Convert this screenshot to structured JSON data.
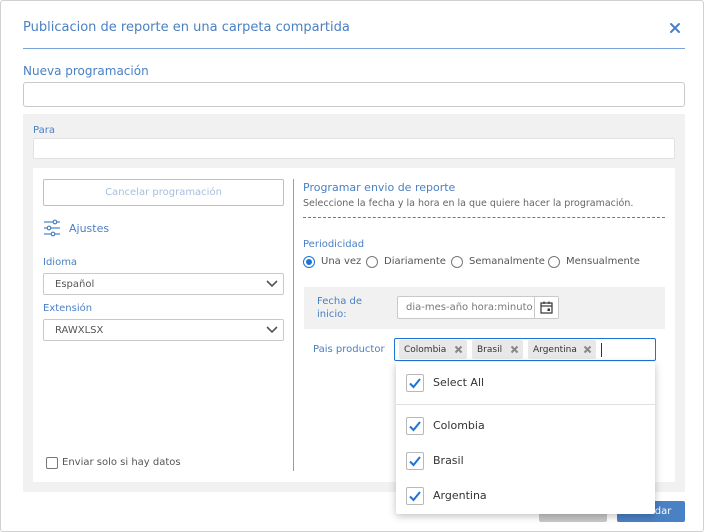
{
  "dialog": {
    "title": "Publicacion de reporte en una carpeta compartida"
  },
  "nueva_programacion": {
    "label": "Nueva programación",
    "value": ""
  },
  "para": {
    "label": "Para",
    "value": ""
  },
  "left": {
    "cancel_schedule_label": "Cancelar programación",
    "settings_label": "Ajustes",
    "idioma_label": "Idioma",
    "idioma_value": "Español",
    "extension_label": "Extensión",
    "extension_value": "RAWXLSX",
    "only_if_data_label": "Enviar solo si hay datos"
  },
  "schedule": {
    "title": "Programar envio de reporte",
    "subtitle": "Seleccione la fecha y la hora en la que quiere hacer la programación.",
    "periodicidad_label": "Periodicidad",
    "options": [
      {
        "label": "Una vez",
        "selected": true
      },
      {
        "label": "Diariamente",
        "selected": false
      },
      {
        "label": "Semanalmente",
        "selected": false
      },
      {
        "label": "Mensualmente",
        "selected": false
      }
    ],
    "fecha_label": "Fecha de inicio:",
    "fecha_placeholder": "dia-mes-año hora:minuto"
  },
  "pais": {
    "label": "Pais productor",
    "chips": [
      "Colombia",
      "Brasil",
      "Argentina"
    ],
    "dropdown": {
      "select_all": "Select All",
      "items": [
        "Colombia",
        "Brasil",
        "Argentina"
      ]
    }
  },
  "footer": {
    "cancel_label": "Cancelar",
    "save_label": "Guardar"
  },
  "colors": {
    "accent": "#4a80c4",
    "focus": "#1e73d6",
    "panel": "#f1f1f1"
  }
}
